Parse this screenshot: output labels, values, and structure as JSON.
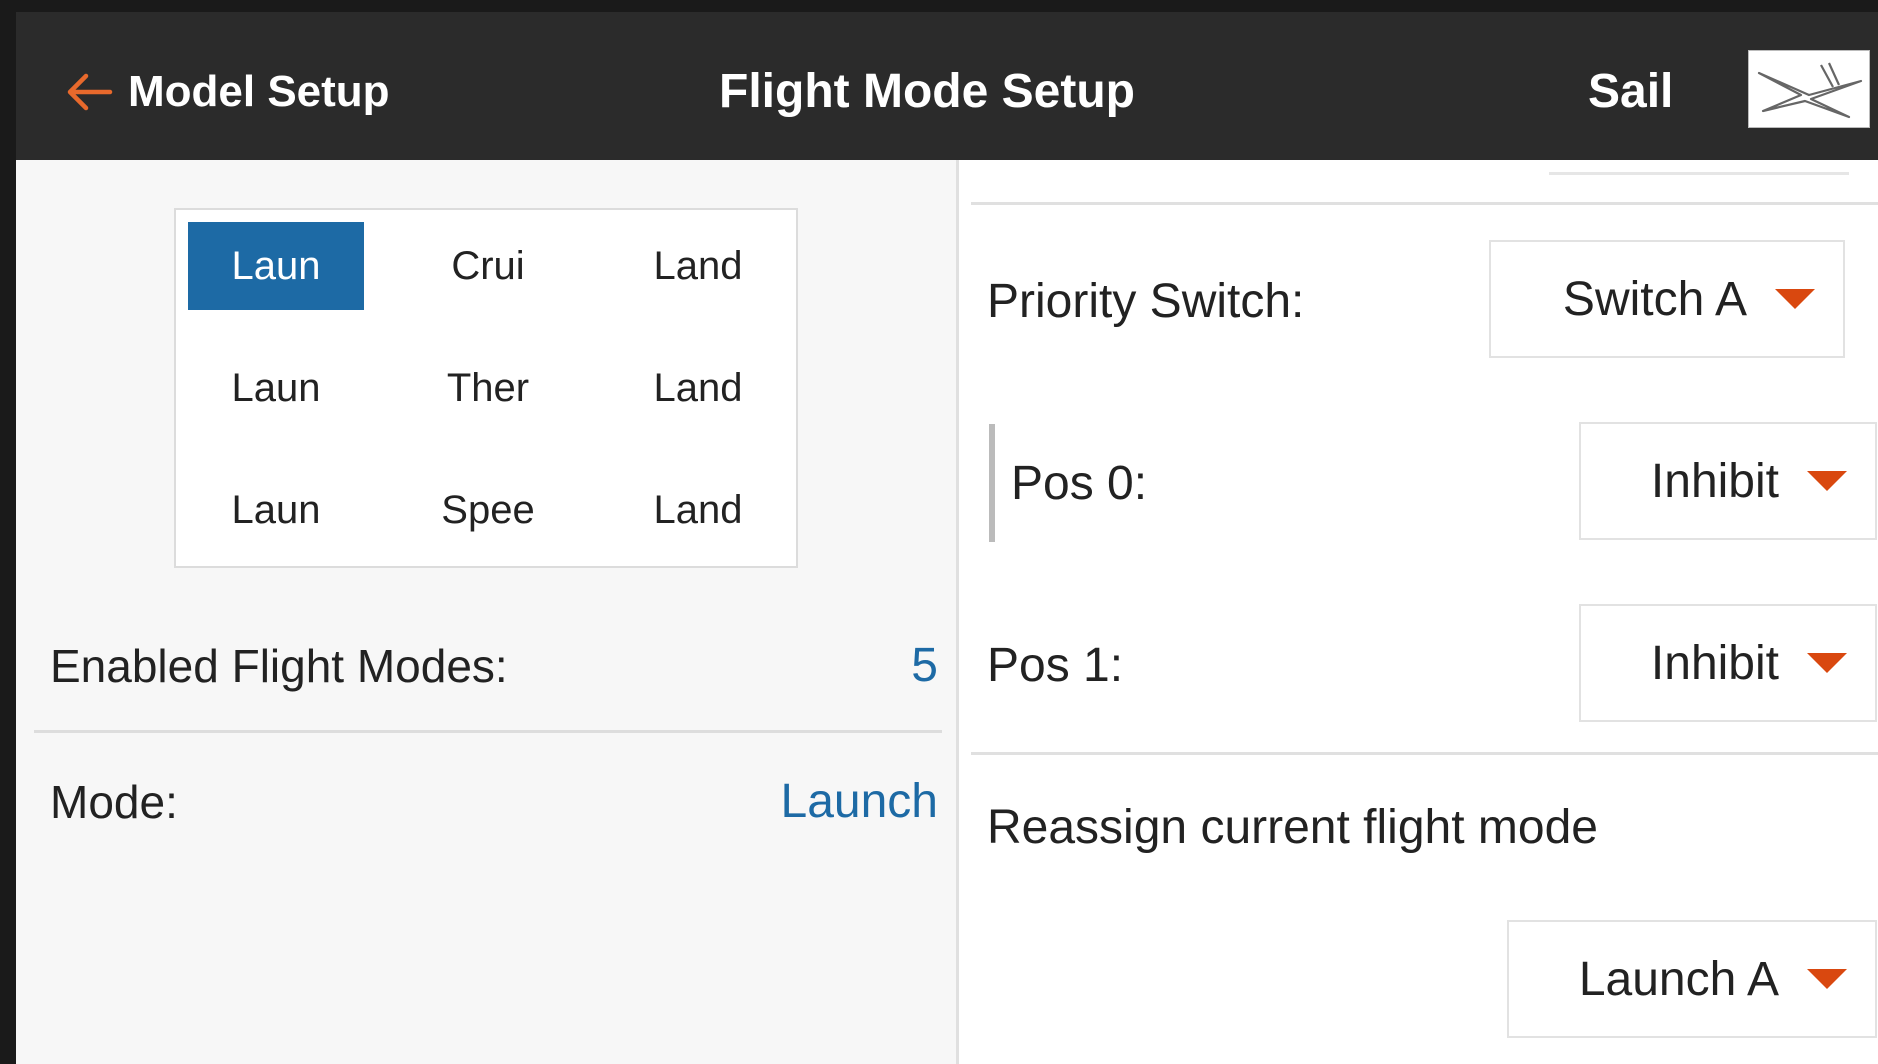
{
  "header": {
    "back_label": "Model Setup",
    "title": "Flight Mode Setup",
    "model_type": "Sail",
    "model_icon": "glider-icon"
  },
  "grid": {
    "cells": [
      [
        "Laun",
        "Crui",
        "Land"
      ],
      [
        "Laun",
        "Ther",
        "Land"
      ],
      [
        "Laun",
        "Spee",
        "Land"
      ]
    ],
    "selected": "0-0"
  },
  "left": {
    "enabled_label": "Enabled Flight Modes:",
    "enabled_value": "5",
    "mode_label": "Mode:",
    "mode_value": "Launch"
  },
  "right": {
    "priority_label": "Priority Switch:",
    "priority_value": "Switch A",
    "pos0_label": "Pos 0:",
    "pos0_value": "Inhibit",
    "pos1_label": "Pos 1:",
    "pos1_value": "Inhibit",
    "reassign_label": "Reassign current flight mode",
    "reassign_value": "Launch A"
  },
  "colors": {
    "header_bg": "#2b2b2b",
    "accent_blue": "#1d6aa5",
    "accent_orange": "#d9480f"
  }
}
